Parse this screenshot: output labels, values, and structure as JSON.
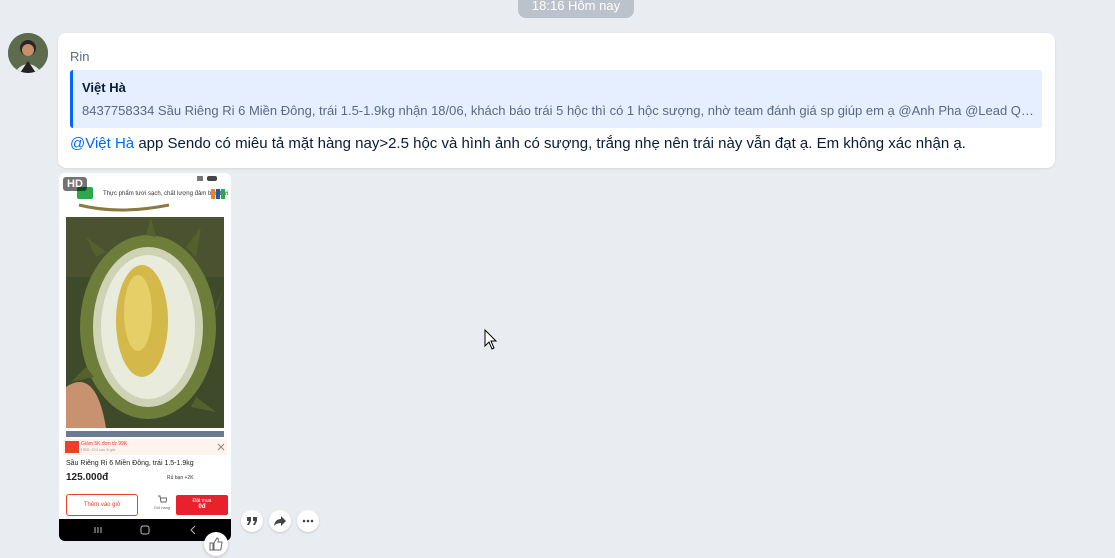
{
  "timestamp": "18:16 Hôm nay",
  "message": {
    "sender": "Rin",
    "quote": {
      "author": "Việt Hà",
      "text": "8437758334 Sầu Riêng Ri 6 Miền Đông, trái 1.5-1.9kg nhận 18/06, khách báo trái 5 hộc thì có 1 hộc sượng, nhờ team đánh giá sp giúp em ạ @Anh Pha @Lead Qc Tr..."
    },
    "mention": "@Việt Hà",
    "body": " app Sendo có miêu tả mặt hàng nay>2.5 hộc và hình ảnh có sượng, trắng nhẹ nên trái này vẫn đạt ạ. Em  không xác nhận ạ."
  },
  "attachment": {
    "badge": "HD",
    "banner_text": "Thực phẩm tươi sạch, chất lượng đảm bảo bởi",
    "promo_line1": "Giảm 5K đơn từ 99K",
    "promo_line2": "HSD: Chỉ còn 5 giờ",
    "product_name": "Sầu Riêng Ri 6 Miền Đông, trái 1.5-1.9kg",
    "price": "125.000đ",
    "seller_tag": "Rủ bạn +2K",
    "add_to_cart": "Thêm vào giỏ",
    "cart_label": "Giỏ hàng",
    "buy_now": "Đặt mua",
    "buy_price": "0đ"
  },
  "icons": {
    "quote": "quote-icon",
    "forward": "forward-icon",
    "more": "more-icon",
    "like": "thumbs-up-icon"
  },
  "colors": {
    "background": "#e9ecf1",
    "accent": "#0068ff",
    "quote_bg": "#e5efff",
    "shop_red": "#e8212c"
  }
}
